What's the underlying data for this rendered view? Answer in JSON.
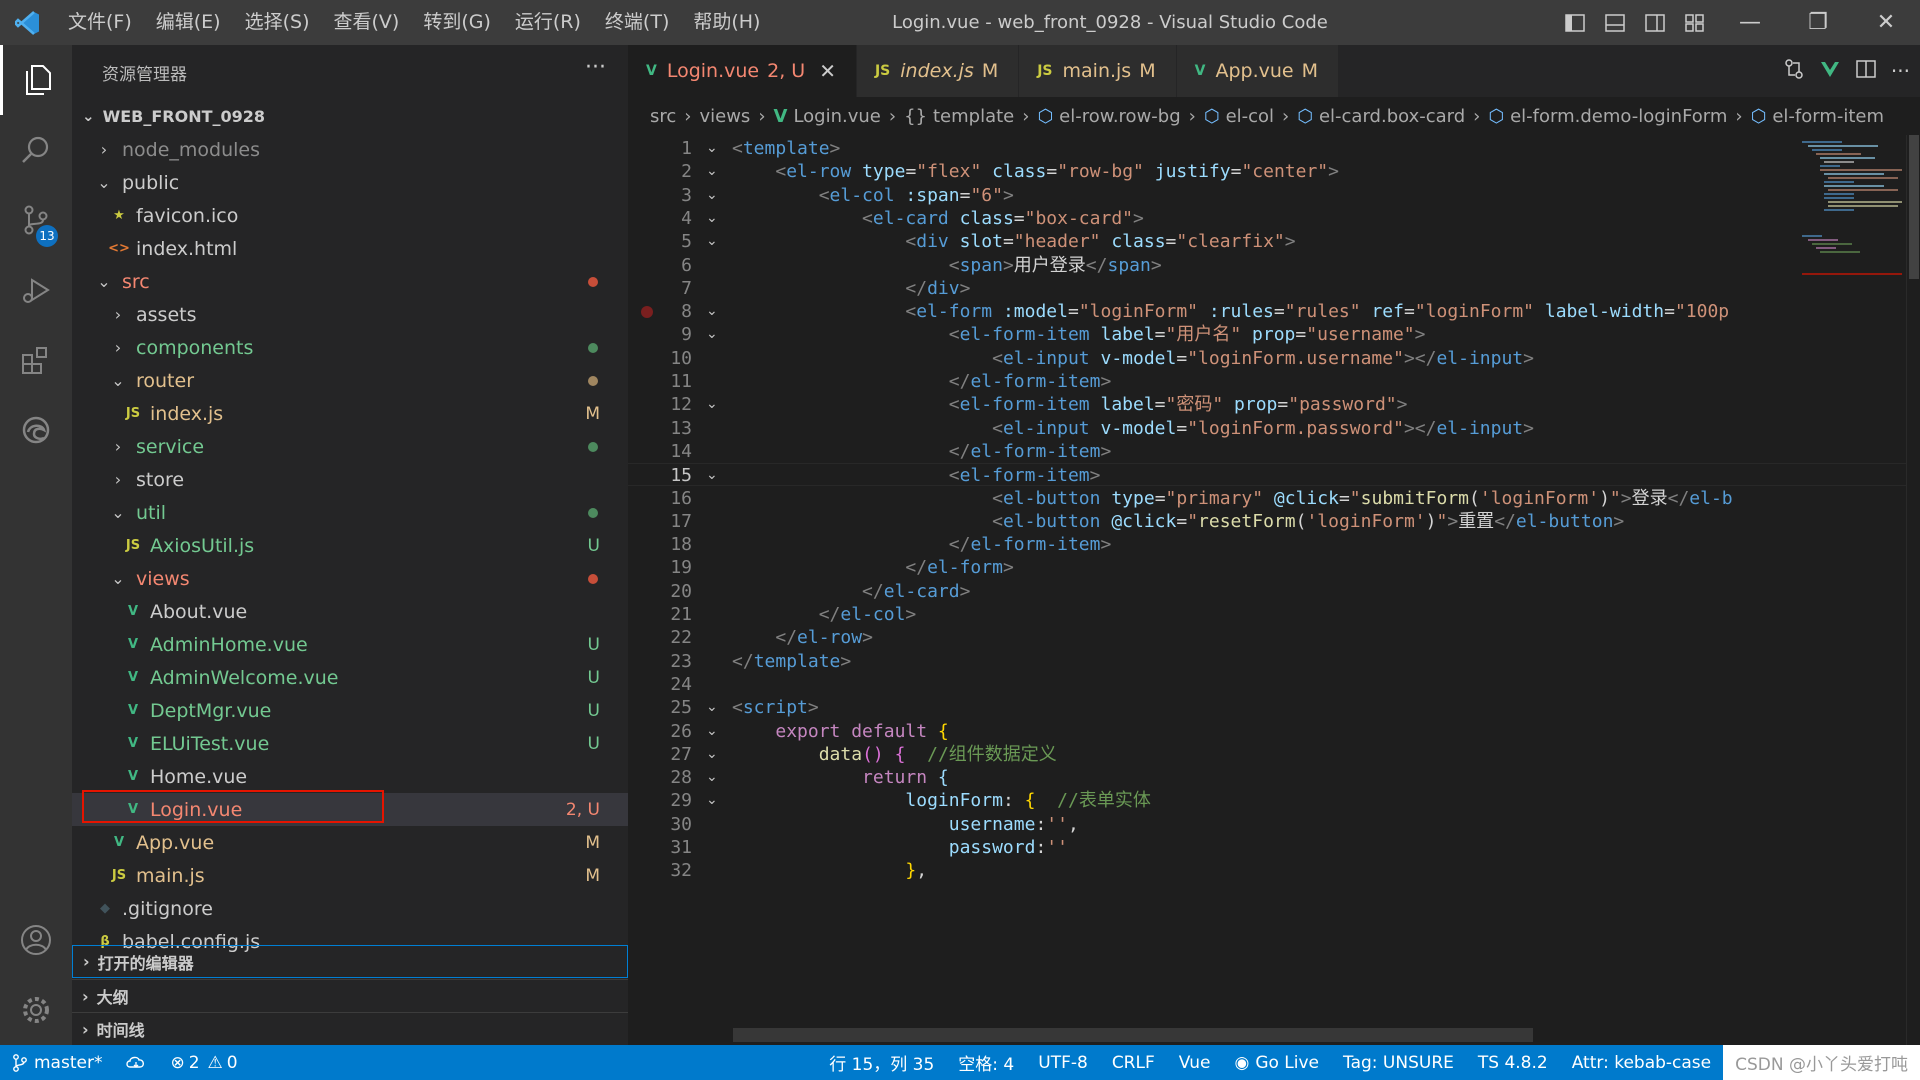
{
  "titlebar": {
    "menus": [
      "文件(F)",
      "编辑(E)",
      "选择(S)",
      "查看(V)",
      "转到(G)",
      "运行(R)",
      "终端(T)",
      "帮助(H)"
    ],
    "title": "Login.vue - web_front_0928 - Visual Studio Code"
  },
  "activity": {
    "scm_badge": "13"
  },
  "sidebar": {
    "header": "资源管理器",
    "more": "···",
    "project": "WEB_FRONT_0928",
    "tree": [
      {
        "label": "node_modules",
        "chev": "›",
        "color": "#8c8c8c",
        "status": ""
      },
      {
        "label": "public",
        "chev": "⌄",
        "color": "#cccccc",
        "status": ""
      },
      {
        "label": "favicon.ico",
        "icon": "★",
        "color": "#cccccc",
        "status": ""
      },
      {
        "label": "index.html",
        "icon": "<>",
        "color": "#cccccc",
        "status": ""
      },
      {
        "label": "src",
        "chev": "⌄",
        "color": "#f48771",
        "status": "dot-red"
      },
      {
        "label": "assets",
        "chev": "›",
        "color": "#cccccc",
        "status": ""
      },
      {
        "label": "components",
        "chev": "›",
        "color": "#73c991",
        "status": "dot-green"
      },
      {
        "label": "router",
        "chev": "⌄",
        "color": "#e2c08d",
        "status": "dot-yellow"
      },
      {
        "label": "index.js",
        "icon": "JS",
        "color": "#e2c08d",
        "status": "M"
      },
      {
        "label": "service",
        "chev": "›",
        "color": "#73c991",
        "status": "dot-green"
      },
      {
        "label": "store",
        "chev": "›",
        "color": "#cccccc",
        "status": ""
      },
      {
        "label": "util",
        "chev": "⌄",
        "color": "#73c991",
        "status": "dot-green"
      },
      {
        "label": "AxiosUtil.js",
        "icon": "JS",
        "color": "#73c991",
        "status": "U"
      },
      {
        "label": "views",
        "chev": "⌄",
        "color": "#f48771",
        "status": "dot-red"
      },
      {
        "label": "About.vue",
        "icon": "V",
        "color": "#cccccc",
        "status": ""
      },
      {
        "label": "AdminHome.vue",
        "icon": "V",
        "color": "#73c991",
        "status": "U"
      },
      {
        "label": "AdminWelcome.vue",
        "icon": "V",
        "color": "#73c991",
        "status": "U"
      },
      {
        "label": "DeptMgr.vue",
        "icon": "V",
        "color": "#73c991",
        "status": "U"
      },
      {
        "label": "ELUiTest.vue",
        "icon": "V",
        "color": "#73c991",
        "status": "U"
      },
      {
        "label": "Home.vue",
        "icon": "V",
        "color": "#cccccc",
        "status": ""
      },
      {
        "label": "Login.vue",
        "icon": "V",
        "color": "#f48771",
        "status": "2, U"
      },
      {
        "label": "App.vue",
        "icon": "V",
        "color": "#e2c08d",
        "status": "M"
      },
      {
        "label": "main.js",
        "icon": "JS",
        "color": "#e2c08d",
        "status": "M"
      },
      {
        "label": ".gitignore",
        "icon": "◆",
        "color": "#cccccc",
        "status": ""
      },
      {
        "label": "babel.config.js",
        "icon": "β",
        "color": "#cccccc",
        "status": ""
      }
    ],
    "sections": [
      "打开的编辑器",
      "大纲",
      "时间线"
    ]
  },
  "tabs": [
    {
      "icon": "V",
      "label": "Login.vue",
      "mod": "2, U",
      "active": true,
      "color": "#f48771"
    },
    {
      "icon": "JS",
      "label": "index.js",
      "mod": "M",
      "active": false,
      "color": "#e2c08d"
    },
    {
      "icon": "JS",
      "label": "main.js",
      "mod": "M",
      "active": false,
      "color": "#e2c08d"
    },
    {
      "icon": "V",
      "label": "App.vue",
      "mod": "M",
      "active": false,
      "color": "#e2c08d"
    }
  ],
  "breadcrumbs": [
    "src",
    "views",
    "Login.vue",
    "template",
    "el-row.row-bg",
    "el-col",
    "el-card.box-card",
    "el-form.demo-loginForm",
    "el-form-item"
  ],
  "code": {
    "current_line": 15,
    "lines": [
      {
        "n": 1,
        "fold": true,
        "html": "<span class='t-br'>&lt;</span><span class='t-tag'>template</span><span class='t-br'>&gt;</span>"
      },
      {
        "n": 2,
        "fold": true,
        "html": "    <span class='t-br'>&lt;</span><span class='t-tag'>el-row</span> <span class='t-attr'>type</span><span class='t-txt'>=</span><span class='t-str'>\"flex\"</span> <span class='t-attr'>class</span><span class='t-txt'>=</span><span class='t-str'>\"row-bg\"</span> <span class='t-attr'>justify</span><span class='t-txt'>=</span><span class='t-str'>\"center\"</span><span class='t-br'>&gt;</span>"
      },
      {
        "n": 3,
        "fold": true,
        "html": "        <span class='t-br'>&lt;</span><span class='t-tag'>el-col</span> <span class='t-attr'>:span</span><span class='t-txt'>=</span><span class='t-str'>\"6\"</span><span class='t-br'>&gt;</span>"
      },
      {
        "n": 4,
        "fold": true,
        "html": "            <span class='t-br'>&lt;</span><span class='t-tag'>el-card</span> <span class='t-attr'>class</span><span class='t-txt'>=</span><span class='t-str'>\"box-card\"</span><span class='t-br'>&gt;</span>"
      },
      {
        "n": 5,
        "fold": true,
        "html": "                <span class='t-br'>&lt;</span><span class='t-tag'>div</span> <span class='t-attr'>slot</span><span class='t-txt'>=</span><span class='t-str'>\"header\"</span> <span class='t-attr'>class</span><span class='t-txt'>=</span><span class='t-str'>\"clearfix\"</span><span class='t-br'>&gt;</span>"
      },
      {
        "n": 6,
        "fold": false,
        "html": "                    <span class='t-br'>&lt;</span><span class='t-tag'>span</span><span class='t-br'>&gt;</span><span class='t-txt'>用户登录</span><span class='t-br'>&lt;/</span><span class='t-tag'>span</span><span class='t-br'>&gt;</span>"
      },
      {
        "n": 7,
        "fold": false,
        "html": "                <span class='t-br'>&lt;/</span><span class='t-tag'>div</span><span class='t-br'>&gt;</span>"
      },
      {
        "n": 8,
        "fold": true,
        "bp": true,
        "html": "                <span class='t-br'>&lt;</span><span class='t-tag'>el-form</span> <span class='t-attr'>:model</span><span class='t-txt'>=</span><span class='t-str'>\"loginForm\"</span> <span class='t-attr'>:rules</span><span class='t-txt'>=</span><span class='t-str'>\"rules\"</span> <span class='t-attr'>ref</span><span class='t-txt'>=</span><span class='t-str'>\"loginForm\"</span> <span class='t-attr'>label-width</span><span class='t-txt'>=</span><span class='t-str'>\"100p</span>"
      },
      {
        "n": 9,
        "fold": true,
        "html": "                    <span class='t-br'>&lt;</span><span class='t-tag'>el-form-item</span> <span class='t-attr'>label</span><span class='t-txt'>=</span><span class='t-str'>\"用户名\"</span> <span class='t-attr'>prop</span><span class='t-txt'>=</span><span class='t-str'>\"username\"</span><span class='t-br'>&gt;</span>"
      },
      {
        "n": 10,
        "fold": false,
        "html": "                        <span class='t-br'>&lt;</span><span class='t-tag'>el-input</span> <span class='t-attr'>v-model</span><span class='t-txt'>=</span><span class='t-str'>\"loginForm.username\"</span><span class='t-br'>&gt;&lt;/</span><span class='t-tag'>el-input</span><span class='t-br'>&gt;</span>"
      },
      {
        "n": 11,
        "fold": false,
        "html": "                    <span class='t-br'>&lt;/</span><span class='t-tag'>el-form-item</span><span class='t-br'>&gt;</span>"
      },
      {
        "n": 12,
        "fold": true,
        "html": "                    <span class='t-br'>&lt;</span><span class='t-tag'>el-form-item</span> <span class='t-attr'>label</span><span class='t-txt'>=</span><span class='t-str'>\"密码\"</span> <span class='t-attr'>prop</span><span class='t-txt'>=</span><span class='t-str'>\"password\"</span><span class='t-br'>&gt;</span>"
      },
      {
        "n": 13,
        "fold": false,
        "html": "                        <span class='t-br'>&lt;</span><span class='t-tag'>el-input</span> <span class='t-attr'>v-model</span><span class='t-txt'>=</span><span class='t-str'>\"loginForm.password\"</span><span class='t-br'>&gt;&lt;/</span><span class='t-tag'>el-input</span><span class='t-br'>&gt;</span>"
      },
      {
        "n": 14,
        "fold": false,
        "html": "                    <span class='t-br'>&lt;/</span><span class='t-tag'>el-form-item</span><span class='t-br'>&gt;</span>"
      },
      {
        "n": 15,
        "fold": true,
        "html": "                    <span class='t-br'>&lt;</span><span class='t-tag'>el-form-item</span><span class='t-br'>&gt;</span>"
      },
      {
        "n": 16,
        "fold": false,
        "html": "                        <span class='t-br'>&lt;</span><span class='t-tag'>el-button</span> <span class='t-attr'>type</span><span class='t-txt'>=</span><span class='t-str'>\"primary\"</span> <span class='t-attr'>@click</span><span class='t-txt'>=</span><span class='t-str'>\"</span><span class='t-fn'>submitForm</span><span class='t-txt'>(</span><span class='t-str'>'loginForm'</span><span class='t-txt'>)</span><span class='t-str'>\"</span><span class='t-br'>&gt;</span><span class='t-txt'>登录</span><span class='t-br'>&lt;/</span><span class='t-tag'>el-b</span>"
      },
      {
        "n": 17,
        "fold": false,
        "html": "                        <span class='t-br'>&lt;</span><span class='t-tag'>el-button</span> <span class='t-attr'>@click</span><span class='t-txt'>=</span><span class='t-str'>\"</span><span class='t-fn'>resetForm</span><span class='t-txt'>(</span><span class='t-str'>'loginForm'</span><span class='t-txt'>)</span><span class='t-str'>\"</span><span class='t-br'>&gt;</span><span class='t-txt'>重置</span><span class='t-br'>&lt;/</span><span class='t-tag'>el-button</span><span class='t-br'>&gt;</span>"
      },
      {
        "n": 18,
        "fold": false,
        "html": "                    <span class='t-br'>&lt;/</span><span class='t-tag'>el-form-item</span><span class='t-br'>&gt;</span>"
      },
      {
        "n": 19,
        "fold": false,
        "html": "                <span class='t-br'>&lt;/</span><span class='t-tag'>el-form</span><span class='t-br'>&gt;</span>"
      },
      {
        "n": 20,
        "fold": false,
        "html": "            <span class='t-br'>&lt;/</span><span class='t-tag'>el-card</span><span class='t-br'>&gt;</span>"
      },
      {
        "n": 21,
        "fold": false,
        "html": "        <span class='t-br'>&lt;/</span><span class='t-tag'>el-col</span><span class='t-br'>&gt;</span>"
      },
      {
        "n": 22,
        "fold": false,
        "html": "    <span class='t-br'>&lt;/</span><span class='t-tag'>el-row</span><span class='t-br'>&gt;</span>"
      },
      {
        "n": 23,
        "fold": false,
        "html": "<span class='t-br'>&lt;/</span><span class='t-tag'>template</span><span class='t-br'>&gt;</span>"
      },
      {
        "n": 24,
        "fold": false,
        "html": ""
      },
      {
        "n": 25,
        "fold": true,
        "html": "<span class='t-br'>&lt;</span><span class='t-tag'>script</span><span class='t-br'>&gt;</span>"
      },
      {
        "n": 26,
        "fold": true,
        "html": "    <span class='t-kw'>export default</span> <span class='t-brace'>{</span>"
      },
      {
        "n": 27,
        "fold": true,
        "html": "        <span class='t-fn'>data</span><span class='t-brace2'>()</span> <span class='t-brace2'>{</span>  <span class='t-com'>//组件数据定义</span>"
      },
      {
        "n": 28,
        "fold": true,
        "html": "            <span class='t-kw'>return</span> <span class='t-attr'>{</span>"
      },
      {
        "n": 29,
        "fold": true,
        "html": "                <span class='t-attr'>loginForm</span><span class='t-txt'>:</span> <span class='t-brace'>{</span>  <span class='t-com'>//表单实体</span>"
      },
      {
        "n": 30,
        "fold": false,
        "html": "                    <span class='t-attr'>username</span><span class='t-txt'>:</span><span class='t-str'>''</span><span class='t-txt'>,</span>"
      },
      {
        "n": 31,
        "fold": false,
        "html": "                    <span class='t-attr'>password</span><span class='t-txt'>:</span><span class='t-str'>''</span>"
      },
      {
        "n": 32,
        "fold": false,
        "html": "                <span class='t-brace'>}</span><span class='t-txt'>,</span>"
      }
    ]
  },
  "statusbar": {
    "branch": "master*",
    "errors": "2",
    "warnings": "0",
    "position": "行 15，列 35",
    "spaces": "空格: 4",
    "encoding": "UTF-8",
    "eol": "CRLF",
    "language": "Vue",
    "golive": "Go Live",
    "tag": "Tag: UNSURE",
    "ts": "TS 4.8.2",
    "attr": "Attr: kebab-case",
    "watermark": "CSDN @小丫头爱打吨"
  }
}
